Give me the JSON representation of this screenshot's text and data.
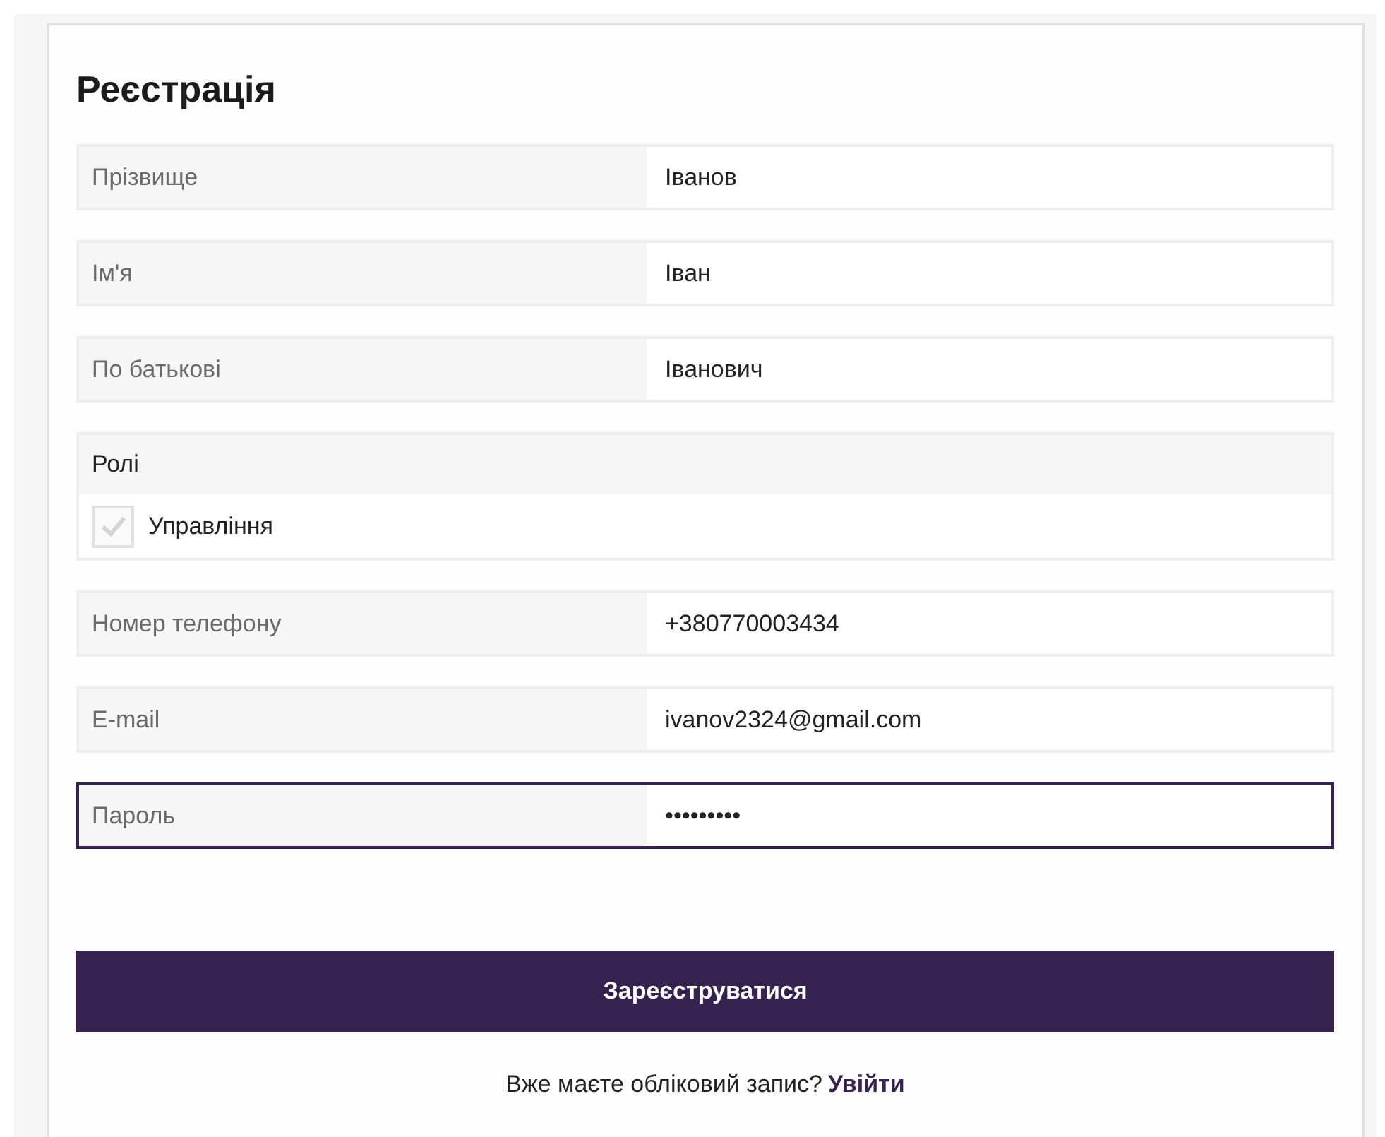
{
  "title": "Реєстрація",
  "fields": [
    {
      "kind": "text",
      "label": "Прізвище",
      "value": "Іванов",
      "focused": false
    },
    {
      "kind": "text",
      "label": "Ім'я",
      "value": "Іван",
      "focused": false
    },
    {
      "kind": "text",
      "label": "По батькові",
      "value": "Іванович",
      "focused": false
    },
    {
      "kind": "roles",
      "label": "Ролі",
      "options": [
        {
          "label": "Управління",
          "checked": true
        }
      ]
    },
    {
      "kind": "text",
      "label": "Номер телефону",
      "value": "+380770003434",
      "focused": false
    },
    {
      "kind": "text",
      "label": "E-mail",
      "value": "ivanov2324@gmail.com",
      "focused": false
    },
    {
      "kind": "text",
      "label": "Пароль",
      "value": "•••••••••",
      "focused": true
    }
  ],
  "submit": "Зареєструватися",
  "footer": {
    "text": "Вже маєте обліковий запис?",
    "link": "Увійти"
  }
}
